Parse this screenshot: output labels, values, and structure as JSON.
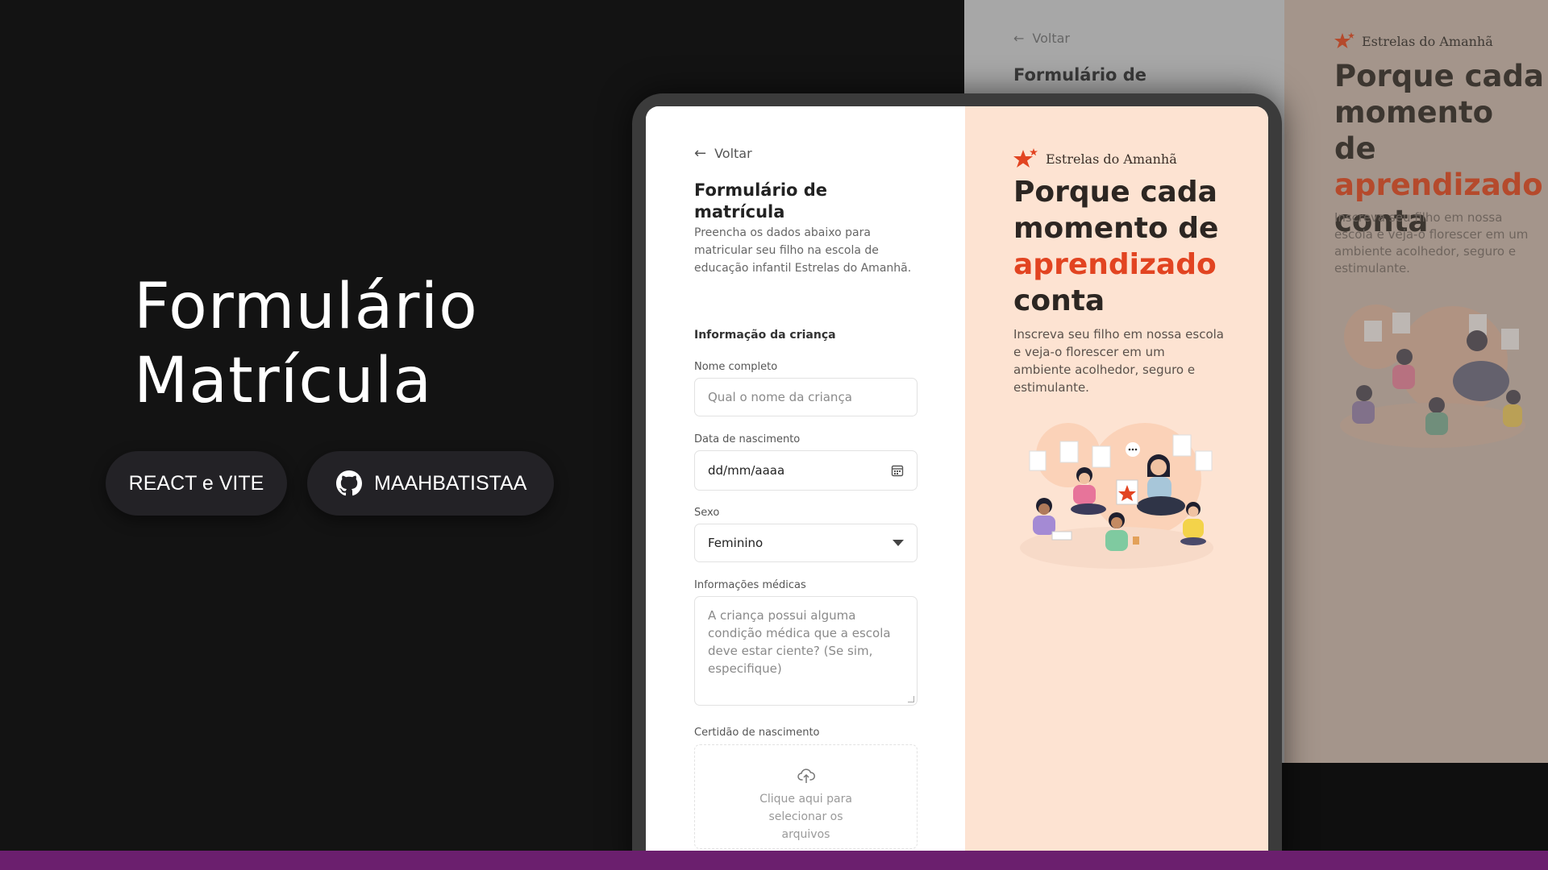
{
  "hero": {
    "title_line1": "Formulário",
    "title_line2": "Matrícula",
    "tech_pill": "REACT e VITE",
    "github_pill": "MAAHBATISTAA"
  },
  "form": {
    "back_label": "Voltar",
    "title": "Formulário de matrícula",
    "intro": "Preencha os dados abaixo para matricular seu filho na escola de educação infantil Estrelas do Amanhã.",
    "section_child": "Informação da criança",
    "fields": {
      "name_label": "Nome completo",
      "name_placeholder": "Qual o nome da criança",
      "birth_label": "Data de nascimento",
      "birth_placeholder": "dd/mm/aaaa",
      "sex_label": "Sexo",
      "sex_value": "Feminino",
      "medical_label": "Informações médicas",
      "medical_placeholder": "A criança possui alguma condição médica que a escola deve estar ciente? (Se sim, especifique)",
      "certificate_label": "Certidão de nascimento",
      "upload_text": "Clique aqui para selecionar os arquivos"
    }
  },
  "promo": {
    "brand": "Estrelas do Amanhã",
    "headline_part1": "Porque cada momento de ",
    "headline_accent": "aprendizado",
    "headline_part2": " conta",
    "description": "Inscreva seu filho em nossa escola e veja-o florescer em um ambiente acolhedor, seguro e estimulante.",
    "illustration": "children-classroom-illustration"
  },
  "background_page": {
    "back_label": "Voltar",
    "form_title_partial": "Formulário de",
    "brand": "Estrelas do Amanhã",
    "headline_part1": "Porque cada momento de ",
    "headline_accent": "aprendizado",
    "headline_part2": " conta",
    "description": "Inscreva seu filho em nossa escola e veja-o florescer em um ambiente acolhedor, seguro e estimulante."
  },
  "colors": {
    "background": "#131313",
    "pill": "#232226",
    "accent_orange": "#e24421",
    "promo_bg": "#fde3d2",
    "bottom_bar": "#6b1f6e"
  }
}
